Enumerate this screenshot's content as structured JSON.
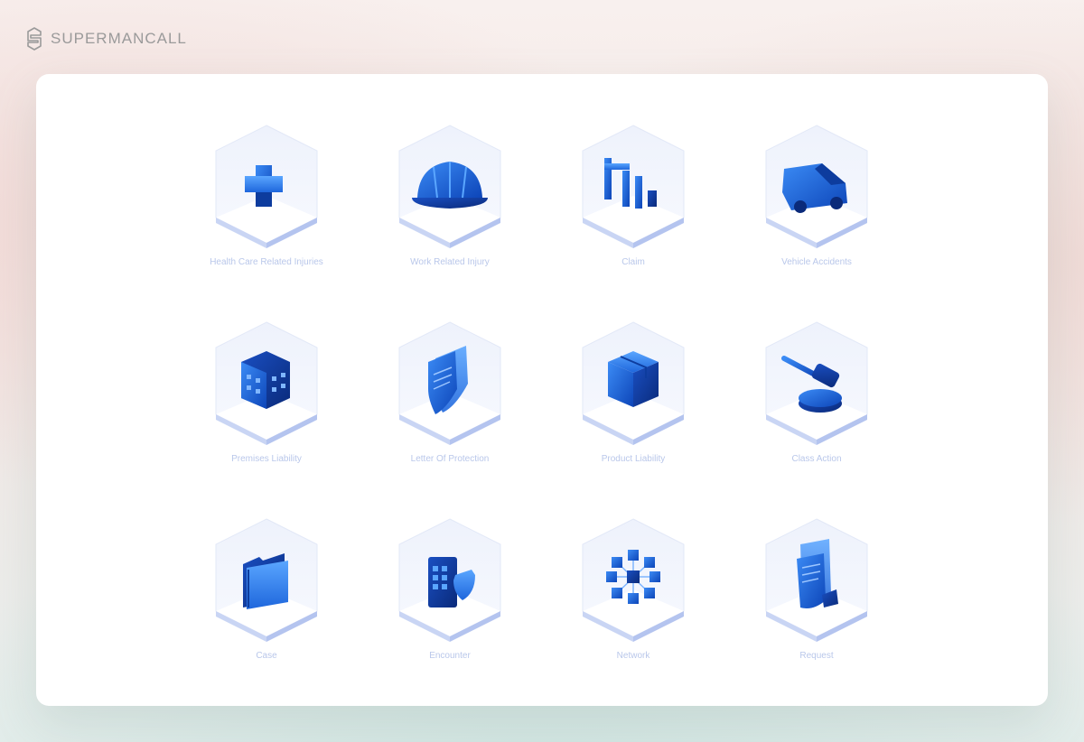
{
  "brand": {
    "name": "SUPERMANCALL"
  },
  "tiles": [
    {
      "label": "Health Care Related Injuries",
      "icon": "medical-cross-icon"
    },
    {
      "label": "Work Related Injury",
      "icon": "hard-hat-icon"
    },
    {
      "label": "Claim",
      "icon": "claim-chart-icon"
    },
    {
      "label": "Vehicle Accidents",
      "icon": "van-icon"
    },
    {
      "label": "Premises Liability",
      "icon": "building-icon"
    },
    {
      "label": "Letter Of Protection",
      "icon": "document-shield-icon"
    },
    {
      "label": "Product Liability",
      "icon": "package-box-icon"
    },
    {
      "label": "Class Action",
      "icon": "gavel-icon"
    },
    {
      "label": "Case",
      "icon": "folder-icon"
    },
    {
      "label": "Encounter",
      "icon": "phone-shield-icon"
    },
    {
      "label": "Network",
      "icon": "network-cubes-icon"
    },
    {
      "label": "Request",
      "icon": "receipt-icon"
    }
  ],
  "colors": {
    "accent": "#1f6fe0",
    "accent_dark": "#0d3c9e",
    "label": "#b9c7ea",
    "brand_text": "#9a9a9a"
  }
}
